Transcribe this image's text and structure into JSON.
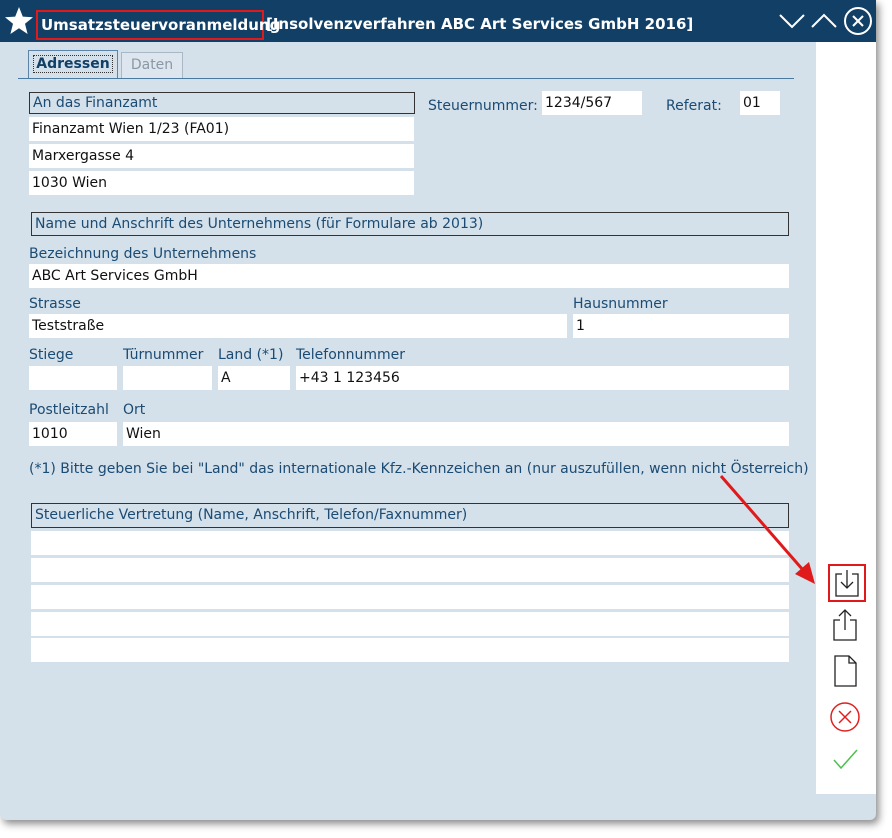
{
  "window": {
    "title": "Umsatzsteuervoranmeldung",
    "subtitle": "[Insolvenzverfahren ABC Art Services GmbH 2016]"
  },
  "tabs": [
    {
      "label": "Adressen",
      "active": true
    },
    {
      "label": "Daten",
      "active": false
    }
  ],
  "finanzamt": {
    "header": "An das Finanzamt",
    "line1": "Finanzamt Wien 1/23 (FA01)",
    "line2": "Marxergasse 4",
    "line3": "1030 Wien"
  },
  "steuer": {
    "steuernummer_label": "Steuernummer:",
    "steuernummer_value": "1234/567",
    "referat_label": "Referat:",
    "referat_value": "01"
  },
  "unternehmen": {
    "header": "Name und Anschrift des Unternehmens (für Formulare ab 2013)",
    "bezeichnung_label": "Bezeichnung des Unternehmens",
    "bezeichnung_value": "ABC Art Services GmbH",
    "strasse_label": "Strasse",
    "strasse_value": "Teststraße",
    "hausnummer_label": "Hausnummer",
    "hausnummer_value": "1",
    "stiege_label": "Stiege",
    "stiege_value": "",
    "tuernummer_label": "Türnummer",
    "tuernummer_value": "",
    "land_label": "Land (*1)",
    "land_value": "A",
    "telefon_label": "Telefonnummer",
    "telefon_value": "+43 1 123456",
    "plz_label": "Postleitzahl",
    "plz_value": "1010",
    "ort_label": "Ort",
    "ort_value": "Wien"
  },
  "note": "(*1) Bitte geben Sie bei \"Land\" das internationale Kfz.-Kennzeichen an (nur auszufüllen, wenn nicht Österreich)",
  "vertretung": {
    "header": "Steuerliche Vertretung (Name, Anschrift, Telefon/Faxnummer)",
    "lines": [
      "",
      "",
      "",
      "",
      ""
    ]
  },
  "sidebar_icons": [
    "import-icon",
    "export-icon",
    "new-document-icon",
    "cancel-icon",
    "confirm-icon"
  ],
  "colors": {
    "titlebar": "#113f66",
    "background": "#d4e0ea",
    "label": "#1b4b73",
    "highlight": "#e01a1a",
    "cancel": "#e02020",
    "confirm": "#4cc04c"
  }
}
